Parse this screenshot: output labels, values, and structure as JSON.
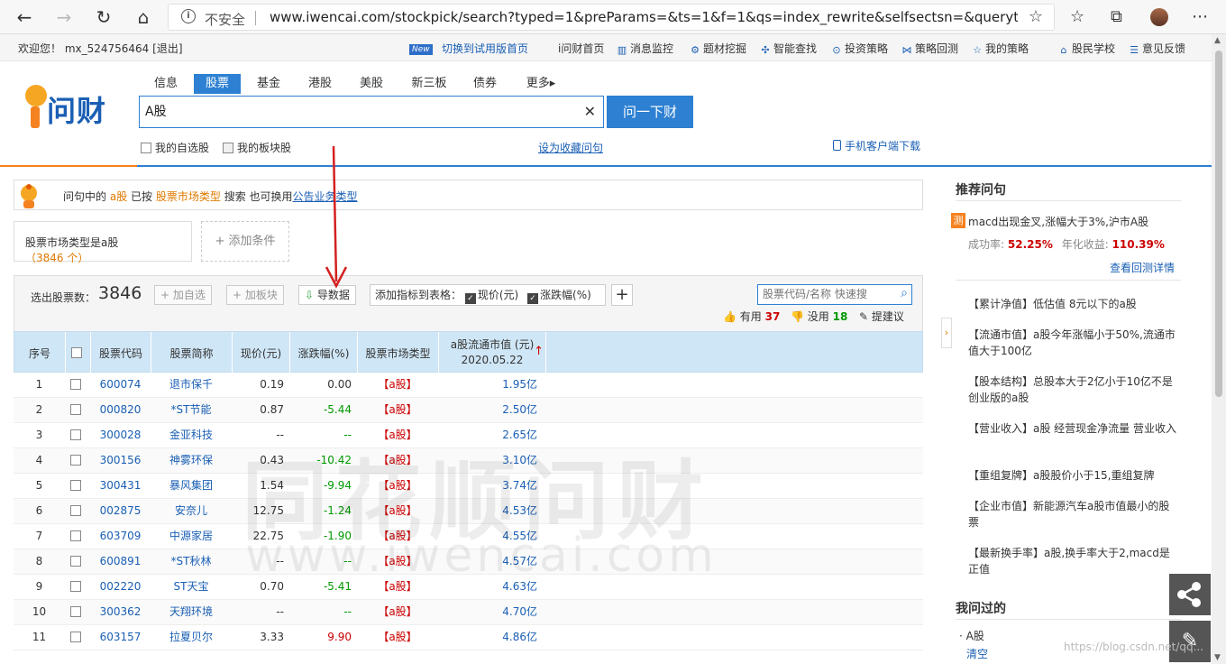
{
  "browser": {
    "insecure_label": "不安全",
    "url": "www.iwencai.com/stockpick/search?typed=1&preParams=&ts=1&f=1&qs=index_rewrite&selfsectsn=&querytype=..."
  },
  "topbar": {
    "welcome": "欢迎您！ mx_524756464 [退出]",
    "new_badge": "New",
    "switch_trial": "切换到试用版首页",
    "links": [
      "i问财首页",
      "消息监控",
      "题材挖掘",
      "智能查找",
      "投资策略",
      "策略回测",
      "我的策略",
      "股民学校",
      "意见反馈"
    ]
  },
  "logo": {
    "text": "问财"
  },
  "tabs": [
    "信息",
    "股票",
    "基金",
    "港股",
    "美股",
    "新三板",
    "债券",
    "更多▸"
  ],
  "search": {
    "value": "A股",
    "button": "问一下财"
  },
  "sub_options": {
    "my_watch": "我的自选股",
    "my_sector": "我的板块股",
    "set_fav": "设为收藏问句",
    "mobile": "手机客户端下载"
  },
  "notice": {
    "p1": "问句中的",
    "term": "a股",
    "p2": "已按",
    "type": "股票市场类型",
    "p3": "搜索   也可换用",
    "alt": "公告业务类型"
  },
  "condition": {
    "label": "股票市场类型是a股",
    "count": "（3846 个）",
    "add": "添加条件"
  },
  "panel": {
    "selected_label": "选出股票数：",
    "selected_count": "3846",
    "add_watch": "加自选",
    "add_sector": "加板块",
    "export": "导数据",
    "add_indicator": "添加指标到表格：",
    "ind1": "现价(元)",
    "ind2": "涨跌幅(%)",
    "search_placeholder": "股票代码/名称 快速搜",
    "useful": "有用",
    "useful_count": "37",
    "useless": "没用",
    "useless_count": "18",
    "suggest": "提建议"
  },
  "table": {
    "headers": [
      "序号",
      "股票代码",
      "股票简称",
      "现价(元)",
      "涨跌幅(%)",
      "股票市场类型",
      "a股流通市值 (元)",
      "2020.05.22"
    ],
    "rows": [
      {
        "no": "1",
        "code": "600074",
        "name": "退市保千",
        "price": "0.19",
        "chg": "0.00",
        "dir": "flat",
        "mkt": "【a股】",
        "cap": "1.95亿"
      },
      {
        "no": "2",
        "code": "000820",
        "name": "*ST节能",
        "price": "0.87",
        "chg": "-5.44",
        "dir": "dn",
        "mkt": "【a股】",
        "cap": "2.50亿"
      },
      {
        "no": "3",
        "code": "300028",
        "name": "金亚科技",
        "price": "--",
        "chg": "--",
        "dir": "dn",
        "mkt": "【a股】",
        "cap": "2.65亿"
      },
      {
        "no": "4",
        "code": "300156",
        "name": "神雾环保",
        "price": "0.43",
        "chg": "-10.42",
        "dir": "dn",
        "mkt": "【a股】",
        "cap": "3.10亿"
      },
      {
        "no": "5",
        "code": "300431",
        "name": "暴风集团",
        "price": "1.54",
        "chg": "-9.94",
        "dir": "dn",
        "mkt": "【a股】",
        "cap": "3.74亿"
      },
      {
        "no": "6",
        "code": "002875",
        "name": "安奈儿",
        "price": "12.75",
        "chg": "-1.24",
        "dir": "dn",
        "mkt": "【a股】",
        "cap": "4.53亿"
      },
      {
        "no": "7",
        "code": "603709",
        "name": "中源家居",
        "price": "22.75",
        "chg": "-1.90",
        "dir": "dn",
        "mkt": "【a股】",
        "cap": "4.55亿"
      },
      {
        "no": "8",
        "code": "600891",
        "name": "*ST秋林",
        "price": "--",
        "chg": "--",
        "dir": "dn",
        "mkt": "【a股】",
        "cap": "4.57亿"
      },
      {
        "no": "9",
        "code": "002220",
        "name": "ST天宝",
        "price": "0.70",
        "chg": "-5.41",
        "dir": "dn",
        "mkt": "【a股】",
        "cap": "4.63亿"
      },
      {
        "no": "10",
        "code": "300362",
        "name": "天翔环境",
        "price": "--",
        "chg": "--",
        "dir": "dn",
        "mkt": "【a股】",
        "cap": "4.70亿"
      },
      {
        "no": "11",
        "code": "603157",
        "name": "拉夏贝尔",
        "price": "3.33",
        "chg": "9.90",
        "dir": "up",
        "mkt": "【a股】",
        "cap": "4.86亿"
      }
    ]
  },
  "watermark": {
    "line1": "同花顺问财",
    "line2": "www.iwencai.com"
  },
  "right": {
    "rec_title": "推荐问句",
    "top_badge": "测",
    "top_query": "macd出现金叉,涨幅大于3%,沪市A股",
    "success_label": "成功率:",
    "success_value": "52.25%",
    "annual_label": "年化收益:",
    "annual_value": "110.39%",
    "detail_link": "查看回测详情",
    "recs": [
      "【累计净值】低估值 8元以下的a股",
      "【流通市值】a股今年涨幅小于50%,流通市值大于100亿",
      "【股本结构】总股本大于2亿小于10亿不是创业版的a股",
      "【营业收入】a股 经营现金净流量 营业收入",
      "【重组复牌】a股股价小于15,重组复牌",
      "【企业市值】新能源汽车a股市值最小的股票",
      "【最新换手率】a股,换手率大于2,macd是正值"
    ],
    "asked_title": "我问过的",
    "asked_items": [
      "A股"
    ],
    "clear": "清空"
  },
  "csdn": "https://blog.csdn.net/qq..."
}
